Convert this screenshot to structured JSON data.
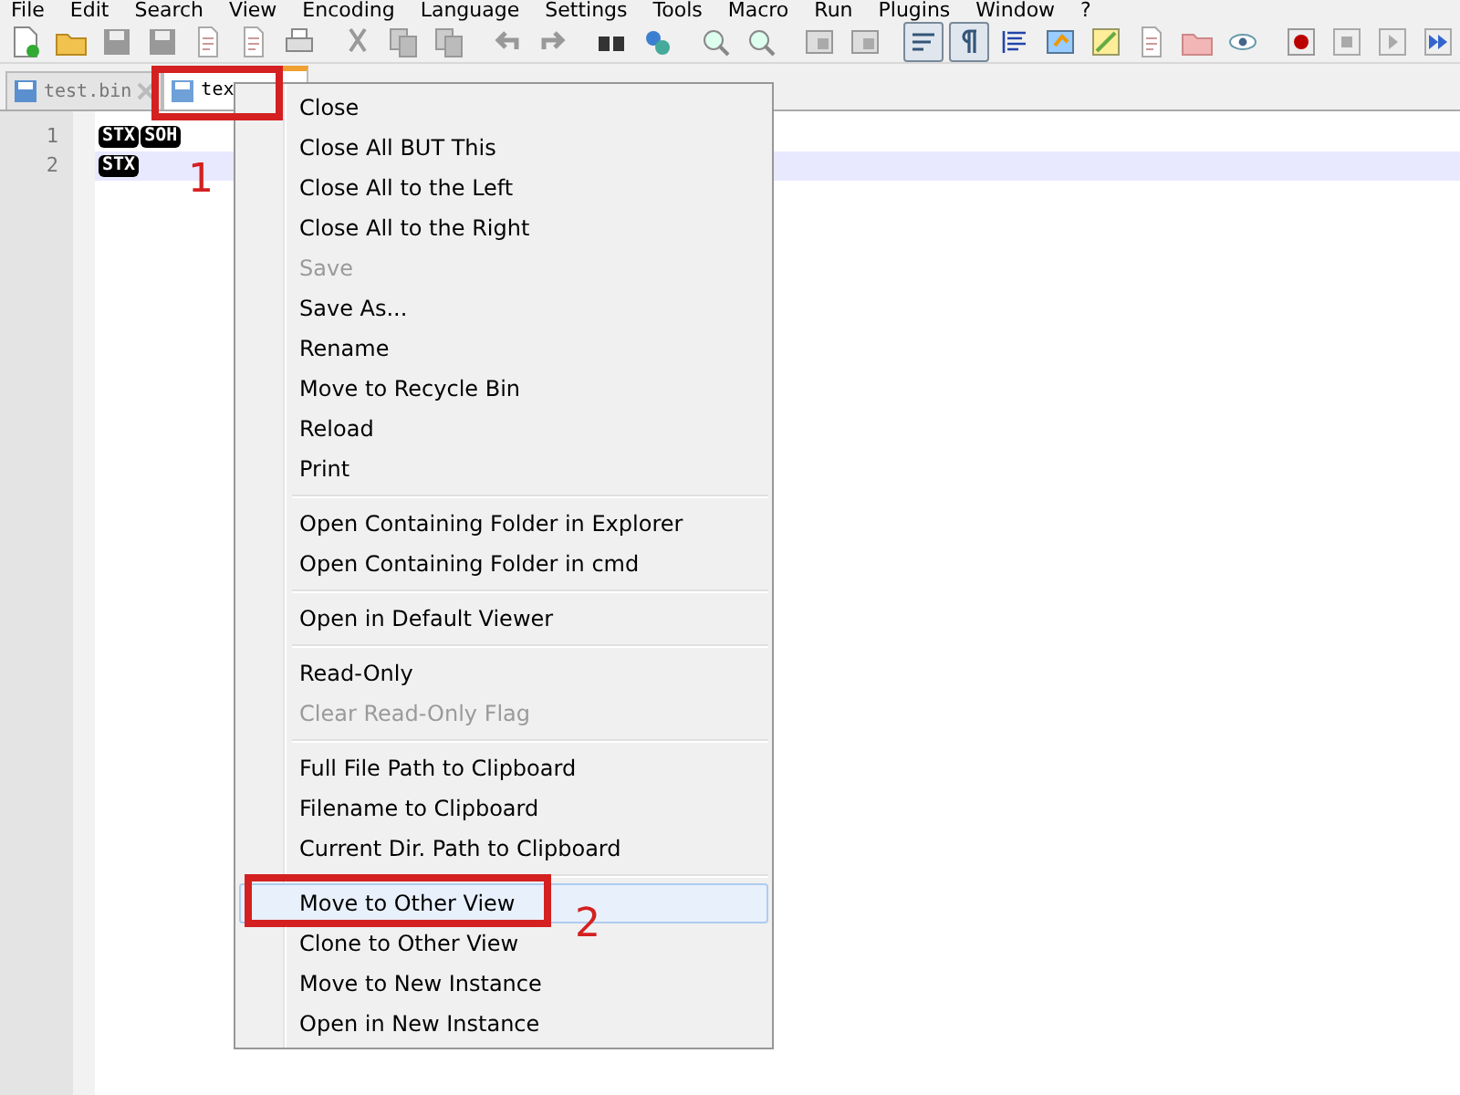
{
  "menu_bar": [
    "File",
    "Edit",
    "Search",
    "View",
    "Encoding",
    "Language",
    "Settings",
    "Tools",
    "Macro",
    "Run",
    "Plugins",
    "Window",
    "?"
  ],
  "tabs": [
    {
      "label": "test.bin",
      "selected": false
    },
    {
      "label": "tex",
      "selected": true
    }
  ],
  "editor": {
    "lines": [
      {
        "number": "1",
        "tokens": [
          "STX",
          "SOH"
        ],
        "current": false
      },
      {
        "number": "2",
        "tokens": [
          "STX"
        ],
        "current": true
      }
    ]
  },
  "context_menu": [
    {
      "kind": "item",
      "label": "Close",
      "selected": false
    },
    {
      "kind": "item",
      "label": "Close All BUT This",
      "selected": false
    },
    {
      "kind": "item",
      "label": "Close All to the Left",
      "selected": false
    },
    {
      "kind": "item",
      "label": "Close All to the Right",
      "selected": false
    },
    {
      "kind": "disabled",
      "label": "Save",
      "selected": false
    },
    {
      "kind": "item",
      "label": "Save As...",
      "selected": false
    },
    {
      "kind": "item",
      "label": "Rename",
      "selected": false
    },
    {
      "kind": "item",
      "label": "Move to Recycle Bin",
      "selected": false
    },
    {
      "kind": "item",
      "label": "Reload",
      "selected": false
    },
    {
      "kind": "item",
      "label": "Print",
      "selected": false
    },
    {
      "kind": "separator"
    },
    {
      "kind": "item",
      "label": "Open Containing Folder in Explorer",
      "selected": false
    },
    {
      "kind": "item",
      "label": "Open Containing Folder in cmd",
      "selected": false
    },
    {
      "kind": "separator"
    },
    {
      "kind": "item",
      "label": "Open in Default Viewer",
      "selected": false
    },
    {
      "kind": "separator"
    },
    {
      "kind": "item",
      "label": "Read-Only",
      "selected": false
    },
    {
      "kind": "disabled",
      "label": "Clear Read-Only Flag",
      "selected": false
    },
    {
      "kind": "separator"
    },
    {
      "kind": "item",
      "label": "Full File Path to Clipboard",
      "selected": false
    },
    {
      "kind": "item",
      "label": "Filename to Clipboard",
      "selected": false
    },
    {
      "kind": "item",
      "label": "Current Dir. Path to Clipboard",
      "selected": false
    },
    {
      "kind": "separator"
    },
    {
      "kind": "item",
      "label": "Move to Other View",
      "selected": true
    },
    {
      "kind": "item",
      "label": "Clone to Other View",
      "selected": false
    },
    {
      "kind": "item",
      "label": "Move to New Instance",
      "selected": false
    },
    {
      "kind": "item",
      "label": "Open in New Instance",
      "selected": false
    }
  ],
  "annotations": [
    {
      "label": "1"
    },
    {
      "label": "2"
    }
  ]
}
